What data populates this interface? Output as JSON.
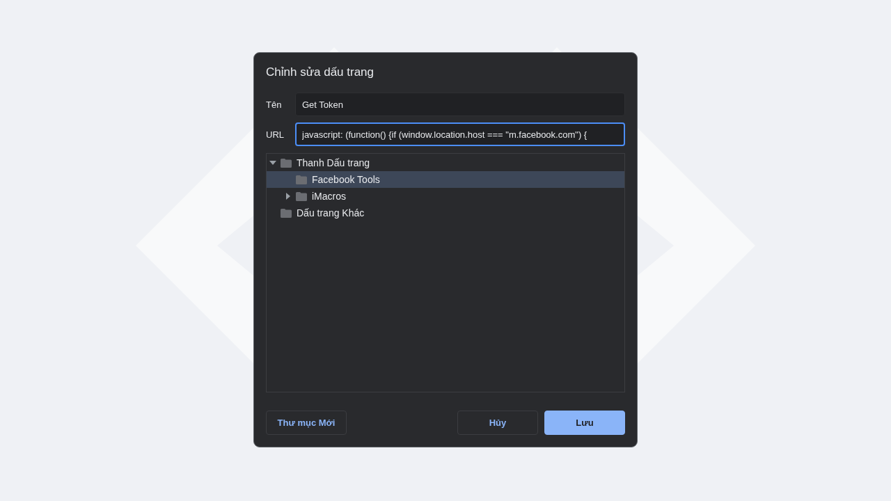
{
  "dialog": {
    "title": "Chỉnh sửa dấu trang",
    "fields": [
      {
        "label": "Tên",
        "value": "Get Token",
        "focused": false
      },
      {
        "label": "URL",
        "value": "javascript: (function() {if (window.location.host === \"m.facebook.com\") {",
        "focused": true
      }
    ],
    "tree": [
      {
        "label": "Thanh Dấu trang",
        "selected": false,
        "expanded": true,
        "children": [
          {
            "label": "Facebook Tools",
            "selected": true
          },
          {
            "label": "iMacros",
            "selected": false,
            "expanded": false
          }
        ]
      },
      {
        "label": "Dấu trang Khác",
        "selected": false
      }
    ],
    "buttons": [
      {
        "label": "Thư mục Mới",
        "kind": "secondary"
      },
      {
        "label": "Hủy",
        "kind": "secondary"
      },
      {
        "label": "Lưu",
        "kind": "primary"
      }
    ]
  }
}
